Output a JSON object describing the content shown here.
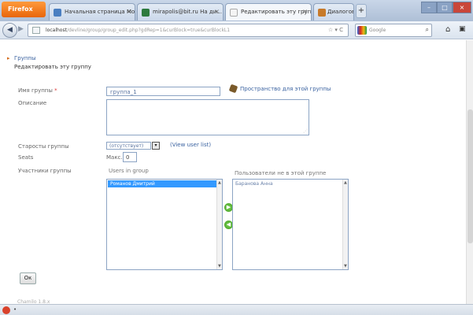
{
  "browser": {
    "app_button": "Firefox",
    "tabs": [
      {
        "label": "Начальная страница Mo..."
      },
      {
        "label": "mirapolis@bit.ru На ди..."
      },
      {
        "label": "Редактировать эту групп..."
      },
      {
        "label": "Диалоговое окно"
      }
    ],
    "new_tab": "+",
    "url_host": "localhost",
    "url_rest": "/devline/group/group_edit.php?gdRep=1&curBlock=true&curBlockL1",
    "search_engine": "Google",
    "colors": {
      "accent": "#3399ff",
      "app_button": "#e8650a"
    }
  },
  "page": {
    "breadcrumb": {
      "parent": "Группы",
      "current": "Редактировать эту группу"
    },
    "form": {
      "name_label": "Имя группы",
      "name_required_mark": "*",
      "name_value": "группа_1",
      "space_link": "Пространство для этой группы",
      "description_label": "Описание",
      "moderator_label": "Старосты группы",
      "moderator_value": "(отсутствует)",
      "view_user_list": "(View user list)",
      "seats_label": "Seats",
      "max_label": "Макс.",
      "max_value": "0",
      "members_label": "Участники группы",
      "users_in_group_label": "Users in group",
      "users_in_group": [
        "Романов Дмитрий"
      ],
      "not_in_group_label": "Пользователи не в этой группе",
      "not_in_group": [
        "Баранова Анна"
      ],
      "ok_button": "Ок"
    },
    "footer_text": "Chamilo 1.8.x"
  },
  "statusbar": {
    "text": "•"
  }
}
